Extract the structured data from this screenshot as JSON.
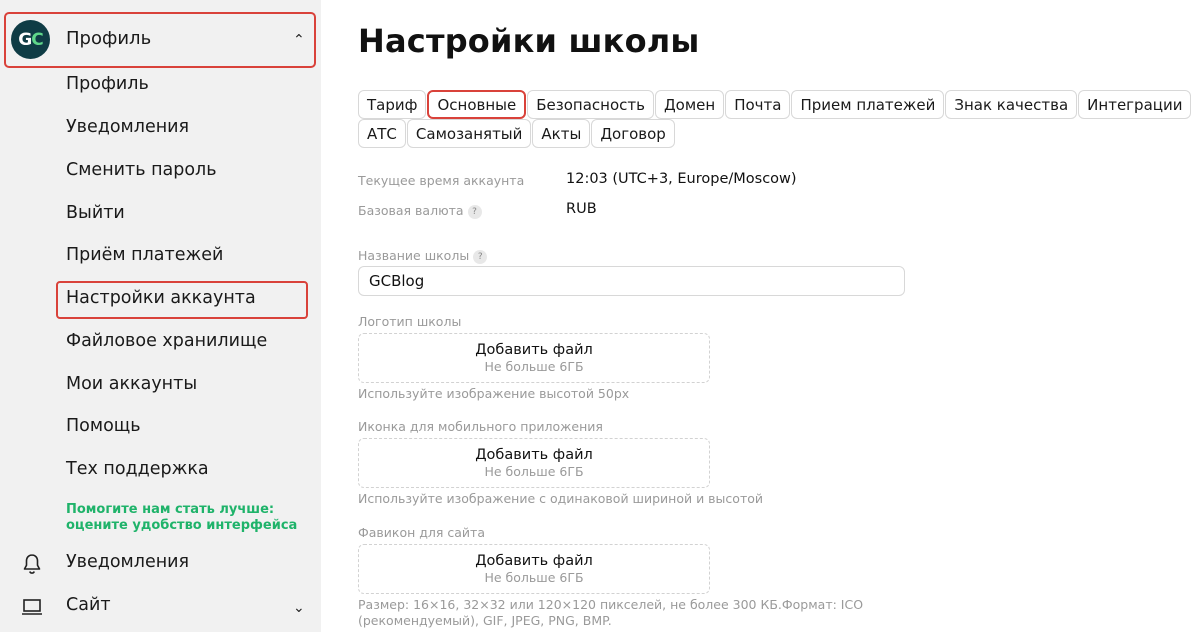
{
  "sidebar": {
    "logo_text": "GC",
    "profile_title": "Профиль",
    "items": [
      {
        "label": "Профиль"
      },
      {
        "label": "Уведомления"
      },
      {
        "label": "Сменить пароль"
      },
      {
        "label": "Выйти"
      },
      {
        "label": "Приём платежей"
      },
      {
        "label": "Настройки аккаунта"
      },
      {
        "label": "Файловое хранилище"
      },
      {
        "label": "Мои аккаунты"
      },
      {
        "label": "Помощь"
      },
      {
        "label": "Тех поддержка"
      }
    ],
    "feedback_line1": "Помогите нам стать лучше:",
    "feedback_line2": "оцените удобство интерфейса",
    "bottom": {
      "notifications_label": "Уведомления",
      "site_label": "Сайт"
    }
  },
  "main": {
    "title": "Настройки школы",
    "tabs_row1": [
      "Тариф",
      "Основные",
      "Безопасность",
      "Домен",
      "Почта",
      "Прием платежей",
      "Знак качества",
      "Интеграции"
    ],
    "tabs_row2": [
      "АТС",
      "Самозанятый",
      "Акты",
      "Договор"
    ],
    "active_tab": "Основные",
    "account_time_label": "Текущее время аккаунта",
    "account_time_value": "12:03 (UTC+3, Europe/Moscow)",
    "currency_label": "Базовая валюта",
    "currency_value": "RUB",
    "school_name_label": "Название школы",
    "school_name_value": "GCBlog",
    "logo_label": "Логотип школы",
    "logo_hint": "Используйте изображение высотой 50px",
    "mobile_icon_label": "Иконка для мобильного приложения",
    "mobile_icon_hint": "Используйте изображение с одинаковой шириной и высотой",
    "favicon_label": "Фавикон для сайта",
    "favicon_hint_line1": "Размер: 16×16, 32×32 или 120×120 пикселей, не более 300 КБ.Формат: ICO",
    "favicon_hint_line2": "(рекомендуемый), GIF, JPEG, PNG, BMP.",
    "upload_button": "Добавить файл",
    "upload_limit": "Не больше 6ГБ",
    "help_mark": "?"
  },
  "colors": {
    "highlight": "#d9423a",
    "feedback_green": "#1fb36a",
    "logo_bg": "#0f3c45"
  }
}
